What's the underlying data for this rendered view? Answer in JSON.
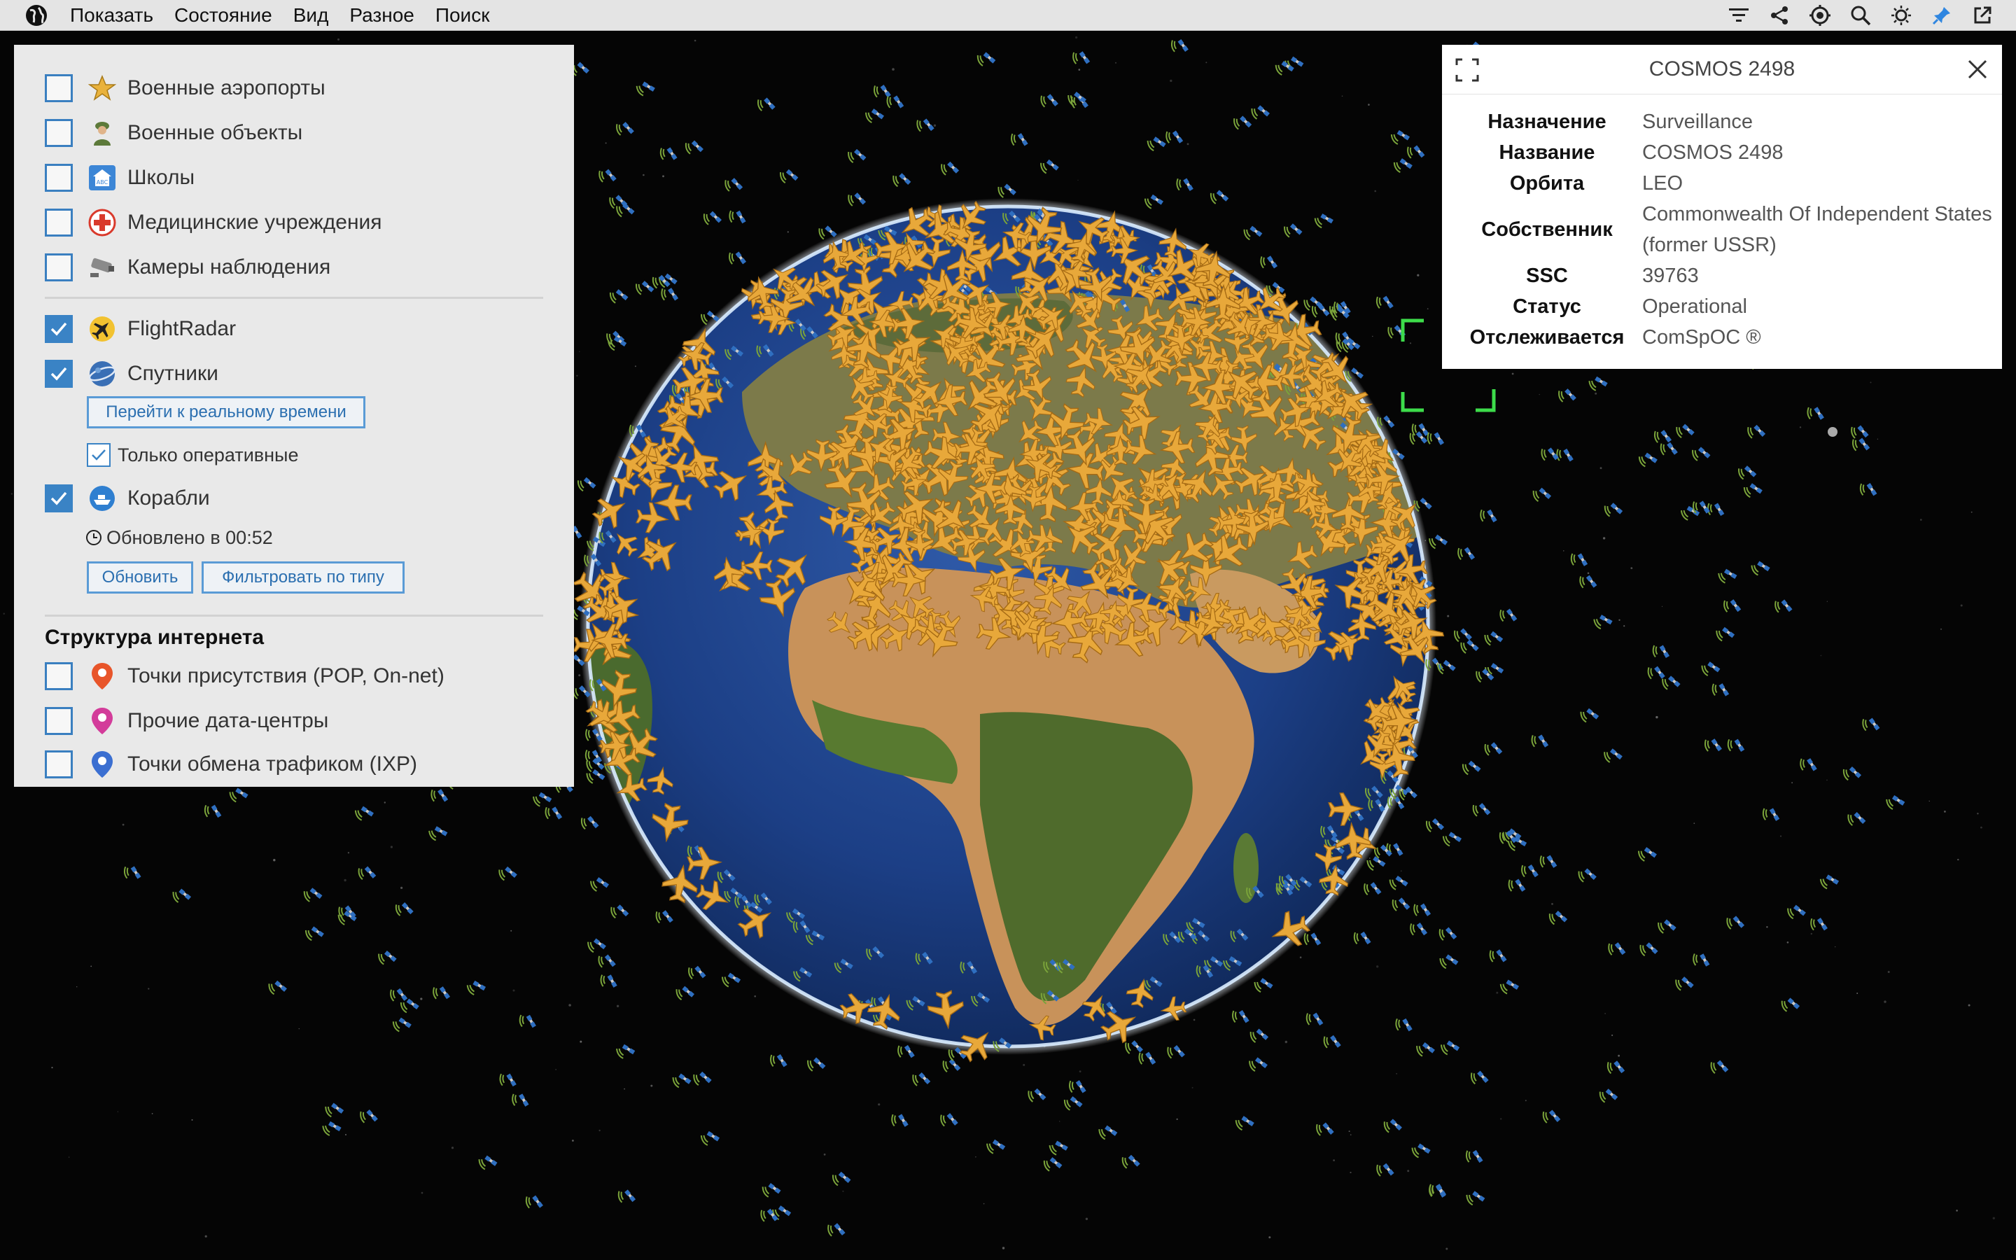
{
  "menubar": {
    "items": [
      "Показать",
      "Состояние",
      "Вид",
      "Разное",
      "Поиск"
    ],
    "right_icons": [
      "filter-icon",
      "share-icon",
      "locate-icon",
      "search-icon",
      "brightness-icon",
      "pin-icon",
      "external-link-icon"
    ]
  },
  "layers": {
    "items": [
      {
        "label": "Военные аэропорты",
        "checked": false,
        "icon": "military-airport-icon"
      },
      {
        "label": "Военные объекты",
        "checked": false,
        "icon": "soldier-icon"
      },
      {
        "label": "Школы",
        "checked": false,
        "icon": "school-icon"
      },
      {
        "label": "Медицинские учреждения",
        "checked": false,
        "icon": "medical-cross-icon"
      },
      {
        "label": "Камеры наблюдения",
        "checked": false,
        "icon": "camera-icon"
      },
      {
        "label": "FlightRadar",
        "checked": true,
        "icon": "airplane-icon"
      },
      {
        "label": "Спутники",
        "checked": true,
        "icon": "satellite-icon"
      },
      {
        "label": "Корабли",
        "checked": true,
        "icon": "ship-icon"
      }
    ],
    "realtime_button": "Перейти к реальному времени",
    "operational_only": {
      "label": "Только оперативные",
      "checked": true
    },
    "updated_text": "Обновлено в 00:52",
    "refresh_button": "Обновить",
    "filter_button": "Фильтровать по типу",
    "internet_section_title": "Структура интернета",
    "internet_items": [
      {
        "label": "Точки присутствия (POP, On-net)",
        "checked": false,
        "icon": "location-pin-icon",
        "color": "#e8552a"
      },
      {
        "label": "Прочие дата-центры",
        "checked": false,
        "icon": "location-pin-icon",
        "color": "#d33c9a"
      },
      {
        "label": "Точки обмена трафиком (IXP)",
        "checked": false,
        "icon": "location-pin-icon",
        "color": "#3b6fd1"
      }
    ]
  },
  "info_panel": {
    "title": "COSMOS 2498",
    "rows": [
      {
        "key": "Назначение",
        "value": "Surveillance"
      },
      {
        "key": "Название",
        "value": "COSMOS 2498"
      },
      {
        "key": "Орбита",
        "value": "LEO"
      },
      {
        "key": "Собственник",
        "value": "Commonwealth Of Independent States (former USSR)"
      },
      {
        "key": "SSC",
        "value": "39763"
      },
      {
        "key": "Статус",
        "value": "Operational"
      },
      {
        "key": "Отслеживается",
        "value": "ComSpOC ®"
      }
    ]
  },
  "colors": {
    "checkbox_accent": "#3a83c5",
    "plane": "#e8a83a",
    "satellite": "#2f6fc0",
    "selection": "#3ddc4a"
  }
}
